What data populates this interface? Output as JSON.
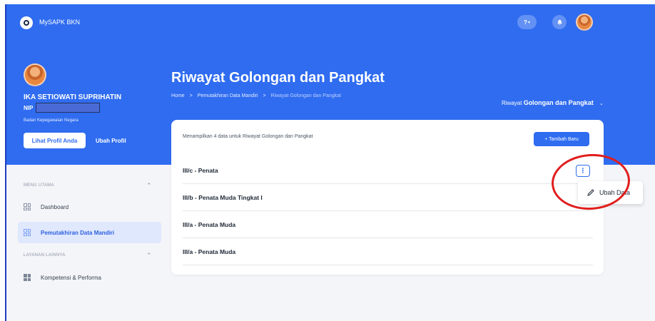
{
  "app": {
    "title": "MySAPK BKN"
  },
  "topbar": {
    "help_label": "?",
    "help_caret": "▾",
    "bell_glyph": "🔔"
  },
  "profile": {
    "name": "IKA SETIOWATI SUPRIHATIN",
    "nip_label": "NIP",
    "org": "Badan Kepegawaian Negara",
    "view_profile_label": "Lihat Profil Anda",
    "edit_profile_label": "Ubah Profil"
  },
  "page": {
    "title": "Riwayat Golongan dan Pangkat",
    "breadcrumb": [
      "Home",
      "Pemutakhiran Data Mandiri",
      "Riwayat Golongan dan Pangkat"
    ],
    "breadcrumb_sep": ">",
    "section_prefix": "Riwayat",
    "section_name": "Golongan dan Pangkat",
    "section_caret": "⌄"
  },
  "sidebar": {
    "main_menu_label": "MENU UTAMA",
    "other_services_label": "LAYANAN LAINNYA",
    "items": [
      {
        "label": "Dashboard"
      },
      {
        "label": "Pemutakhiran Data Mandiri"
      },
      {
        "label": "Kompetensi & Performa"
      }
    ],
    "chev": "⌃"
  },
  "card": {
    "info": "Menampilkan 4 data untuk Riwayat Golongan dan Pangkat",
    "add_label": "+ Tambah Baru",
    "rows": [
      {
        "label": "III/c - Penata"
      },
      {
        "label": "III/b - Penata Muda Tingkat I"
      },
      {
        "label": "III/a - Penata Muda"
      },
      {
        "label": "III/a - Penata Muda"
      }
    ],
    "kebab_glyph": "⋮"
  },
  "dropdown": {
    "edit_label": "Ubah Data"
  },
  "colors": {
    "primary": "#2f6cf0",
    "annotation": "#e11d1d"
  }
}
